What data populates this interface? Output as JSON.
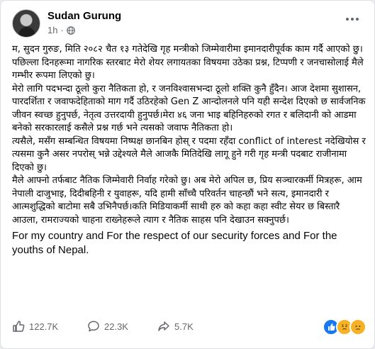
{
  "post": {
    "author": "Sudan Gurung",
    "time": "1h",
    "separator": "·",
    "paragraphs": [
      "म, सुदन गुरुङ, मिति २०८२ चैत १३ गतेदेखि गृह मन्त्रीको जिम्मेवारीमा इमानदारीपूर्वक काम गर्दै आएको छु। पछिल्ला दिनहरूमा नागरिक स्तरबाट मेरो शेयर लगायतका विषयमा उठेका प्रश्न, टिप्पणी र जनचासोलाई मैले गम्भीर रूपमा लिएको छु।",
      "मेरो लागि पदभन्दा ठूलो कुरा नैतिकता हो, र जनविश्वासभन्दा ठूलो शक्ति कुनै हुँदैन। आज देशमा सुशासन, पारदर्शिता र जवाफदेहिताको माग गर्दै उठिरहेको Gen Z आन्दोलनले पनि यही सन्देश दिएको छ सार्वजनिक जीवन स्वच्छ हुनुपर्छ, नेतृत्व उत्तरदायी हुनुपर्छ।मेरा ४६ जना भाइ बहिनिहरुको रगत र बलिदानी को आडमा बनेको सरकारलाई कसैले प्रश्न गर्छ भने त्यसको जवाफ नैतिकता हो।",
      "त्यसैले, मसँग सम्बन्धित विषयमा निष्पक्ष छानबिन होस् र पदमा रहँदा conflict of interest नदेखियोस र  त्यसमा कुनै असर नपरोस् भन्ने उद्देश्यले मैले आजकै मितिदेखि लागू हुने गरी गृह मन्त्री पदबाट राजीनामा दिएको छु।",
      "मैले आफ्नो तर्फबाट नैतिक जिम्मेवारी निर्वाह गरेको छु। अब मेरो अपिल छ, प्रिय सञ्चारकर्मी मित्रहरू, आम नेपाली दाजुभाइ, दिदीबहिनी र युवाहरू, यदि हामी साँच्चै परिवर्तन चाहन्छौं भने सत्य, इमानदारी र आत्मशुद्धिको बाटोमा सबै उभिनैपर्छ।कति मिडियाकर्मी साथी हरु को कहा कहा स्वीट सेयर छ बिस्तारै आउला, रामराज्यको चाहना राख्नेहरूले त्याग र नैतिक साहस पनि देखाउन सक्नुपर्छ।"
    ],
    "english_text": "For my country and For the respect of our security forces and For the youths of Nepal."
  },
  "footer": {
    "likes": "122.7K",
    "comments": "22.3K",
    "shares": "5.7K"
  },
  "icons": {
    "more": "more-options-icon",
    "privacy": "globe-icon",
    "like": "like-icon",
    "comment": "comment-icon",
    "share": "share-icon",
    "reactions": [
      "like-reaction-icon",
      "sad-reaction-icon",
      "cry-reaction-icon"
    ]
  },
  "colors": {
    "text": "#050505",
    "secondary": "#65676b",
    "like_blue": "#1877f2",
    "reaction_yellow": "#f7b125"
  }
}
